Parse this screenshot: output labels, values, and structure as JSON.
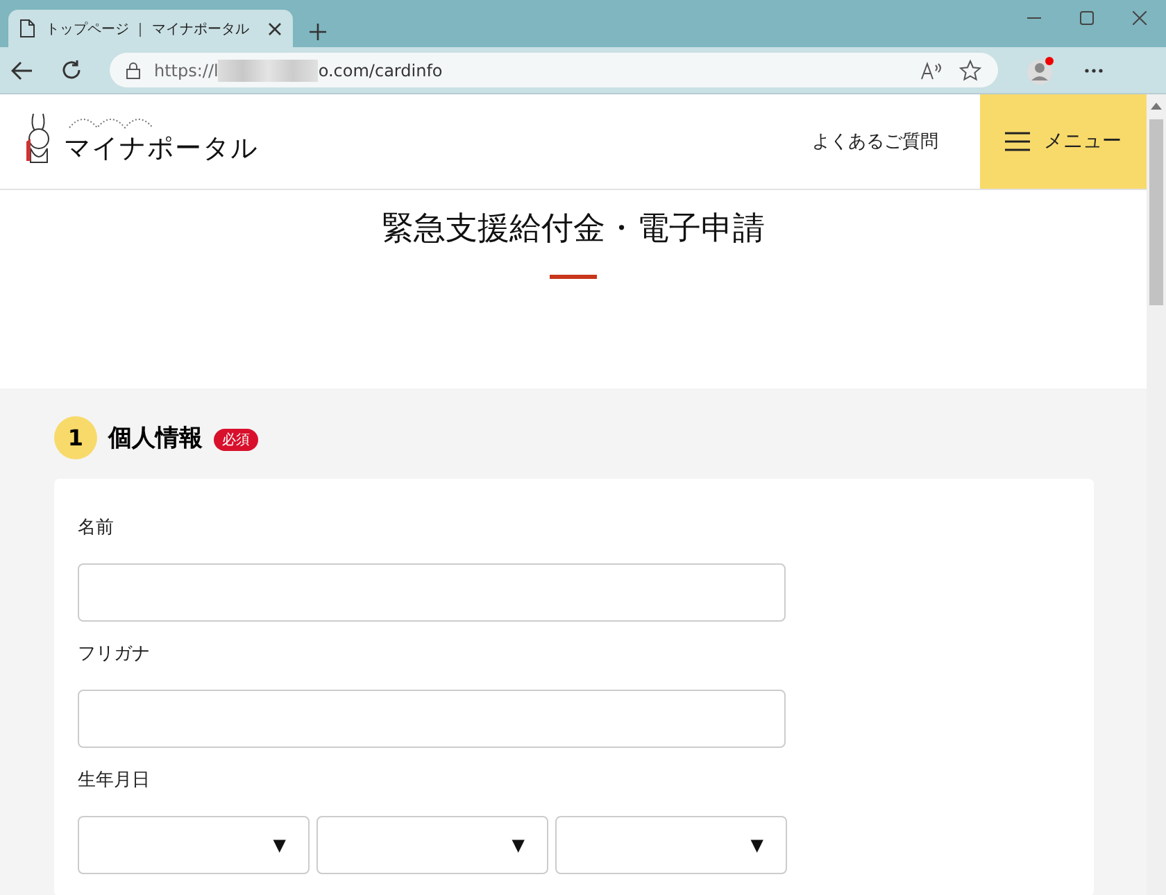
{
  "browser": {
    "tab_title": "トップページ ｜ マイナポータル",
    "url_start": "https://l",
    "url_end": "o.com/cardinfo"
  },
  "header": {
    "logo_text": "マイナポータル",
    "faq_link": "よくあるご質問",
    "menu_button": "メニュー"
  },
  "page_title": "緊急支援給付金・電子申請",
  "section": {
    "number": "1",
    "title": "個人情報",
    "badge": "必須"
  },
  "fields": [
    {
      "kind": "text",
      "label": "名前"
    },
    {
      "kind": "text",
      "label": "フリガナ"
    },
    {
      "kind": "date",
      "label": "生年月日",
      "selects": [
        "▼",
        "▼",
        "▼"
      ]
    }
  ]
}
